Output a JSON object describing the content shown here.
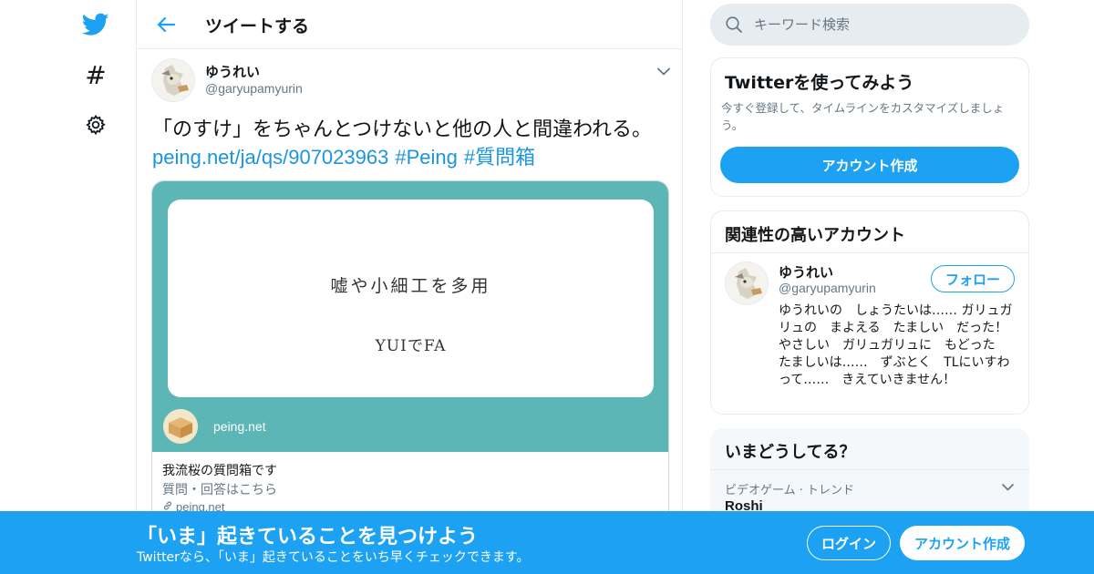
{
  "colors": {
    "accent": "#1da1f2",
    "link": "#1b95e0",
    "card_bg": "#5cb6b5",
    "secondary_text": "#657786"
  },
  "nav": {
    "icons": [
      "twitter-bird-icon",
      "hashtag-icon",
      "gear-icon"
    ],
    "hashtag_glyph": "#"
  },
  "header": {
    "title": "ツイートする"
  },
  "tweet": {
    "author_name": "ゆうれい",
    "author_handle": "@garyupamyurin",
    "text_part1": "「のすけ」をちゃんとつけないと他の人と間違われる。",
    "link_url": "peing.net/ja/qs/907023963",
    "hashtag1": "#Peing",
    "hashtag2": "#質問箱",
    "card": {
      "question_line1": "嘘や小細工を多用",
      "question_line2": "YUIでFA",
      "image_domain": "peing.net",
      "title": "我流桜の質問箱です",
      "description": "質問・回答はこちら",
      "link_domain": "peing.net"
    }
  },
  "search": {
    "placeholder": "キーワード検索"
  },
  "signup_panel": {
    "title": "Twitterを使ってみよう",
    "description": "今すぐ登録して、タイムラインをカスタマイズしましょう。",
    "button_label": "アカウント作成"
  },
  "related_panel": {
    "title": "関連性の高いアカウント",
    "name": "ゆうれい",
    "handle": "@garyupamyurin",
    "follow_label": "フォロー",
    "bio": "ゆうれいの　しょうたいは…… ガリュガリュの　まよえる　たましい　だった！ やさしい　ガリュガリュに　もどった　たましいは……　ずぶとく　TLにいすわって……　きえていきません！"
  },
  "trends_panel": {
    "title": "いまどうしてる？",
    "trend_meta": "ビデオゲーム · トレンド",
    "trend_name": "Roshi"
  },
  "banner": {
    "title": "「いま」起きていることを見つけよう",
    "subtitle": "Twitterなら、「いま」起きていることをいち早くチェックできます。",
    "login_label": "ログイン",
    "signup_label": "アカウント作成"
  }
}
